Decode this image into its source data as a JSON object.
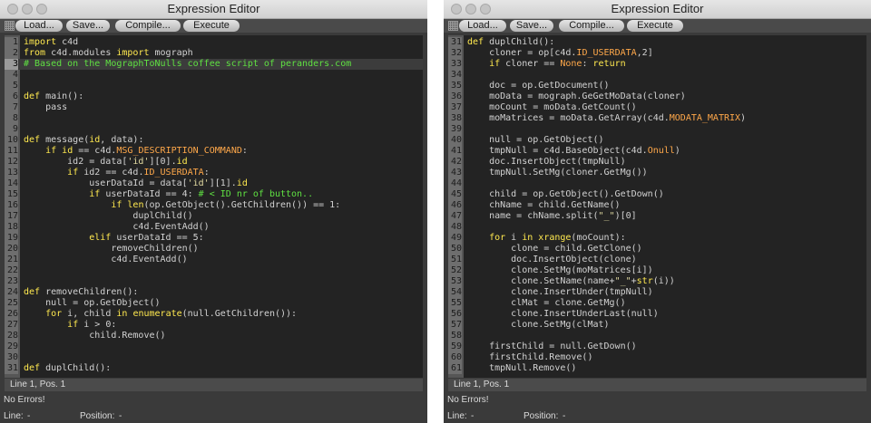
{
  "windows": [
    {
      "title": "Expression Editor",
      "toolbar": {
        "load": "Load...",
        "save": "Save...",
        "compile": "Compile...",
        "execute": "Execute"
      },
      "cursor_status": "Line 1, Pos. 1",
      "message": "No Errors!",
      "line_label": "Line:",
      "line_value": "-",
      "position_label": "Position:",
      "position_value": "-",
      "current_line": 3,
      "code_lines": [
        {
          "n": "1",
          "c": "[[k:import]] c4d"
        },
        {
          "n": "2",
          "c": "[[k:from]] c4d.modules [[k:import]] mograph"
        },
        {
          "n": "3",
          "c": "[[m:# Based on the MographToNulls coffee script of peranders.com]]"
        },
        {
          "n": "4",
          "c": ""
        },
        {
          "n": "5",
          "c": ""
        },
        {
          "n": "6",
          "c": "[[k:def]] main():"
        },
        {
          "n": "7",
          "c": "    pass"
        },
        {
          "n": "8",
          "c": ""
        },
        {
          "n": "9",
          "c": ""
        },
        {
          "n": "10",
          "c": "[[k:def]] message([[k:id]], data):"
        },
        {
          "n": "11",
          "c": "    [[k:if]] [[k:id]] == c4d.[[o:MSG_DESCRIPTION_COMMAND]]:"
        },
        {
          "n": "12",
          "c": "        id2 = data[[[s:'id']]][0].[[k:id]]"
        },
        {
          "n": "13",
          "c": "        [[k:if]] id2 == c4d.[[o:ID_USERDATA]]:"
        },
        {
          "n": "14",
          "c": "            userDataId = data[[[s:'id']]][1].[[k:id]]"
        },
        {
          "n": "15",
          "c": "            [[k:if]] userDataId == 4: [[m:# < ID nr of button..]]"
        },
        {
          "n": "16",
          "c": "                [[k:if]] [[k:len]](op.GetObject().GetChildren()) == 1:"
        },
        {
          "n": "17",
          "c": "                    duplChild()"
        },
        {
          "n": "18",
          "c": "                    c4d.EventAdd()"
        },
        {
          "n": "19",
          "c": "            [[k:elif]] userDataId == 5:"
        },
        {
          "n": "20",
          "c": "                removeChildren()"
        },
        {
          "n": "21",
          "c": "                c4d.EventAdd()"
        },
        {
          "n": "22",
          "c": ""
        },
        {
          "n": "23",
          "c": ""
        },
        {
          "n": "24",
          "c": "[[k:def]] removeChildren():"
        },
        {
          "n": "25",
          "c": "    null = op.GetObject()"
        },
        {
          "n": "26",
          "c": "    [[k:for]] i, child [[k:in]] [[k:enumerate]](null.GetChildren()):"
        },
        {
          "n": "27",
          "c": "        [[k:if]] i > 0:"
        },
        {
          "n": "28",
          "c": "            child.Remove()"
        },
        {
          "n": "29",
          "c": ""
        },
        {
          "n": "30",
          "c": ""
        },
        {
          "n": "31",
          "c": "[[k:def]] duplChild():"
        }
      ]
    },
    {
      "title": "Expression Editor",
      "toolbar": {
        "load": "Load...",
        "save": "Save...",
        "compile": "Compile...",
        "execute": "Execute"
      },
      "cursor_status": "Line 1, Pos. 1",
      "message": "No Errors!",
      "line_label": "Line:",
      "line_value": "-",
      "position_label": "Position:",
      "position_value": "-",
      "current_line": 0,
      "code_lines": [
        {
          "n": "31",
          "c": "[[k:def]] duplChild():"
        },
        {
          "n": "32",
          "c": "    cloner = op[c4d.[[o:ID_USERDATA]],2]"
        },
        {
          "n": "33",
          "c": "    [[k:if]] cloner == [[o:None]]: [[k:return]]"
        },
        {
          "n": "34",
          "c": ""
        },
        {
          "n": "35",
          "c": "    doc = op.GetDocument()"
        },
        {
          "n": "36",
          "c": "    moData = mograph.GeGetMoData(cloner)"
        },
        {
          "n": "37",
          "c": "    moCount = moData.GetCount()"
        },
        {
          "n": "38",
          "c": "    moMatrices = moData.GetArray(c4d.[[o:MODATA_MATRIX]])"
        },
        {
          "n": "39",
          "c": ""
        },
        {
          "n": "40",
          "c": "    null = op.GetObject()"
        },
        {
          "n": "41",
          "c": "    tmpNull = c4d.BaseObject(c4d.[[o:Onull]])"
        },
        {
          "n": "42",
          "c": "    doc.InsertObject(tmpNull)"
        },
        {
          "n": "43",
          "c": "    tmpNull.SetMg(cloner.GetMg())"
        },
        {
          "n": "44",
          "c": ""
        },
        {
          "n": "45",
          "c": "    child = op.GetObject().GetDown()"
        },
        {
          "n": "46",
          "c": "    chName = child.GetName()"
        },
        {
          "n": "47",
          "c": "    name = chName.split([[s:\"_\"]])[0]"
        },
        {
          "n": "48",
          "c": ""
        },
        {
          "n": "49",
          "c": "    [[k:for]] i [[k:in]] [[k:xrange]](moCount):"
        },
        {
          "n": "50",
          "c": "        clone = child.GetClone()"
        },
        {
          "n": "51",
          "c": "        doc.InsertObject(clone)"
        },
        {
          "n": "52",
          "c": "        clone.SetMg(moMatrices[i])"
        },
        {
          "n": "53",
          "c": "        clone.SetName(name+[[s:\"_\"]]+[[k:str]](i))"
        },
        {
          "n": "54",
          "c": "        clone.InsertUnder(tmpNull)"
        },
        {
          "n": "55",
          "c": "        clMat = clone.GetMg()"
        },
        {
          "n": "56",
          "c": "        clone.InsertUnderLast(null)"
        },
        {
          "n": "57",
          "c": "        clone.SetMg(clMat)"
        },
        {
          "n": "58",
          "c": ""
        },
        {
          "n": "59",
          "c": "    firstChild = null.GetDown()"
        },
        {
          "n": "60",
          "c": "    firstChild.Remove()"
        },
        {
          "n": "61",
          "c": "    tmpNull.Remove()"
        }
      ]
    }
  ]
}
